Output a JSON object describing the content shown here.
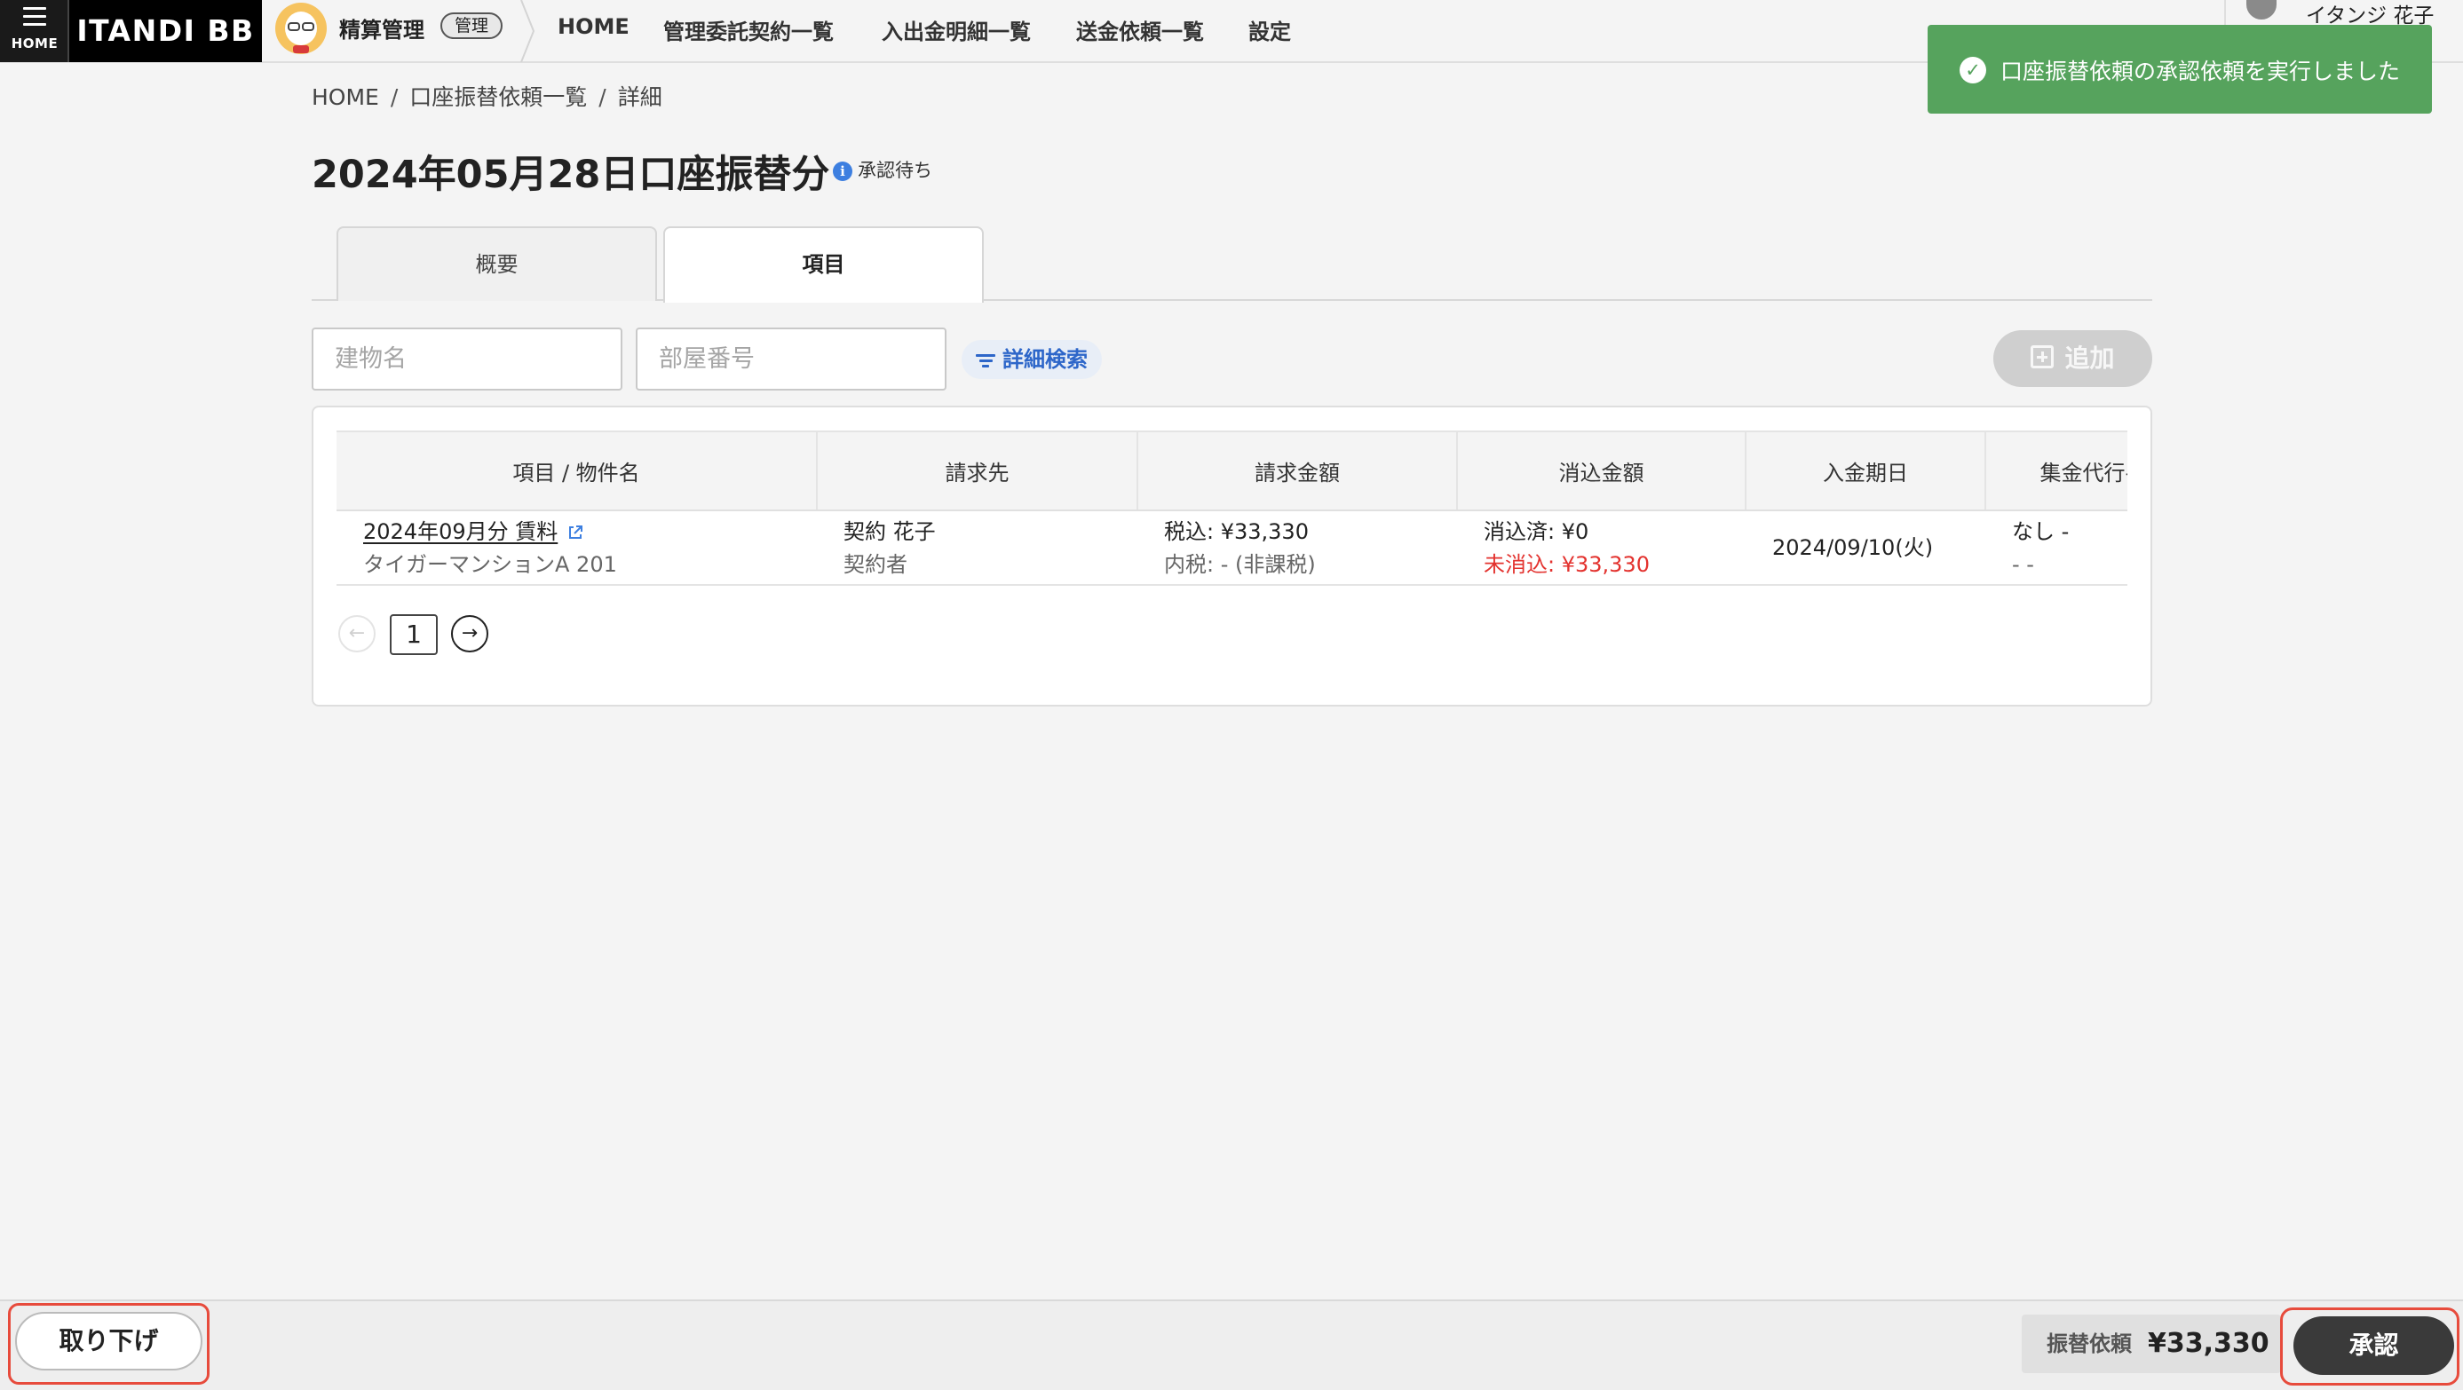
{
  "header": {
    "home_label": "HOME",
    "logo": "ITANDI BB",
    "app_name": "精算管理",
    "app_badge": "管理",
    "nav": [
      "HOME",
      "管理委託契約一覧",
      "入出金明細一覧",
      "送金依頼一覧",
      "設定"
    ],
    "user_name": "イタンジ 花子"
  },
  "toast": {
    "message": "口座振替依頼の承認依頼を実行しました",
    "color": "#56a35d"
  },
  "breadcrumb": [
    "HOME",
    "口座振替依頼一覧",
    "詳細"
  ],
  "page": {
    "title": "2024年05月28日口座振替分",
    "status": "承認待ち"
  },
  "tabs": [
    "概要",
    "項目"
  ],
  "active_tab": "項目",
  "filters": {
    "building_placeholder": "建物名",
    "room_placeholder": "部屋番号",
    "advanced_search": "詳細検索",
    "add_button": "追加"
  },
  "table": {
    "columns": [
      "項目 / 物件名",
      "請求先",
      "請求金額",
      "消込金額",
      "入金期日",
      "集金代行手"
    ],
    "rows": [
      {
        "item": "2024年09月分 賃料",
        "property": "タイガーマンションA 201",
        "billing_name": "契約 花子",
        "billing_role": "契約者",
        "amount_incl": "税込: ¥33,330",
        "amount_tax": "内税: - (非課税)",
        "cleared": "消込済: ¥0",
        "uncleared": "未消込: ¥33,330",
        "due_date": "2024/09/10(火)",
        "agency_1": "なし -",
        "agency_2": "- -"
      }
    ]
  },
  "pagination": {
    "current": "1"
  },
  "footer": {
    "withdraw": "取り下げ",
    "transfer_label": "振替依頼",
    "transfer_amount": "¥33,330",
    "approve": "承認"
  }
}
